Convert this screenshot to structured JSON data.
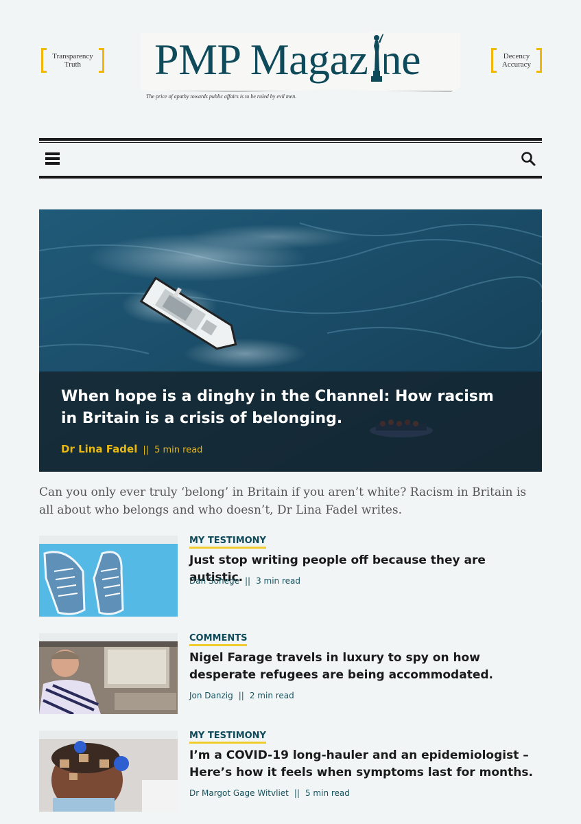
{
  "masthead": {
    "left_box": [
      "Transparency",
      "Truth"
    ],
    "right_box": [
      "Decency",
      "Accuracy"
    ],
    "logo_text": "PMP Magazine",
    "tagline": "The price of apathy towards public affairs is to be ruled by evil men."
  },
  "nav": {
    "menu_icon": "hamburger-menu-icon",
    "search_icon": "search-icon"
  },
  "hero": {
    "title": "When hope is a dinghy in the Channel: How racism in Britain is a crisis of belonging.",
    "author": "Dr Lina Fadel",
    "separator": "||",
    "read_time": "5 min read"
  },
  "excerpt": "Can you only ever truly ‘belong’ in Britain if you aren’t white? Racism in Britain is all about who belongs and who doesn’t, Dr Lina Fadel writes.",
  "articles": [
    {
      "category": "MY TESTIMONY",
      "title": "Just stop writing people off because they are autistic.",
      "author": "Dan Sohege",
      "separator": "||",
      "read_time": "3 min read"
    },
    {
      "category": "COMMENTS",
      "title": "Nigel Farage travels in luxury to spy on how desperate refugees are being accommodated.",
      "author": "Jon Danzig",
      "separator": "||",
      "read_time": "2 min read"
    },
    {
      "category": "MY TESTIMONY",
      "title": "I’m a COVID-19 long-hauler and an epidemiologist – Here’s how it feels when symptoms last for months.",
      "author": "Dr Margot Gage Witvliet",
      "separator": "||",
      "read_time": "5 min read"
    }
  ],
  "colors": {
    "accent_yellow": "#f2b705",
    "brand_teal": "#0e4a5a",
    "background": "#f1f5f5"
  }
}
